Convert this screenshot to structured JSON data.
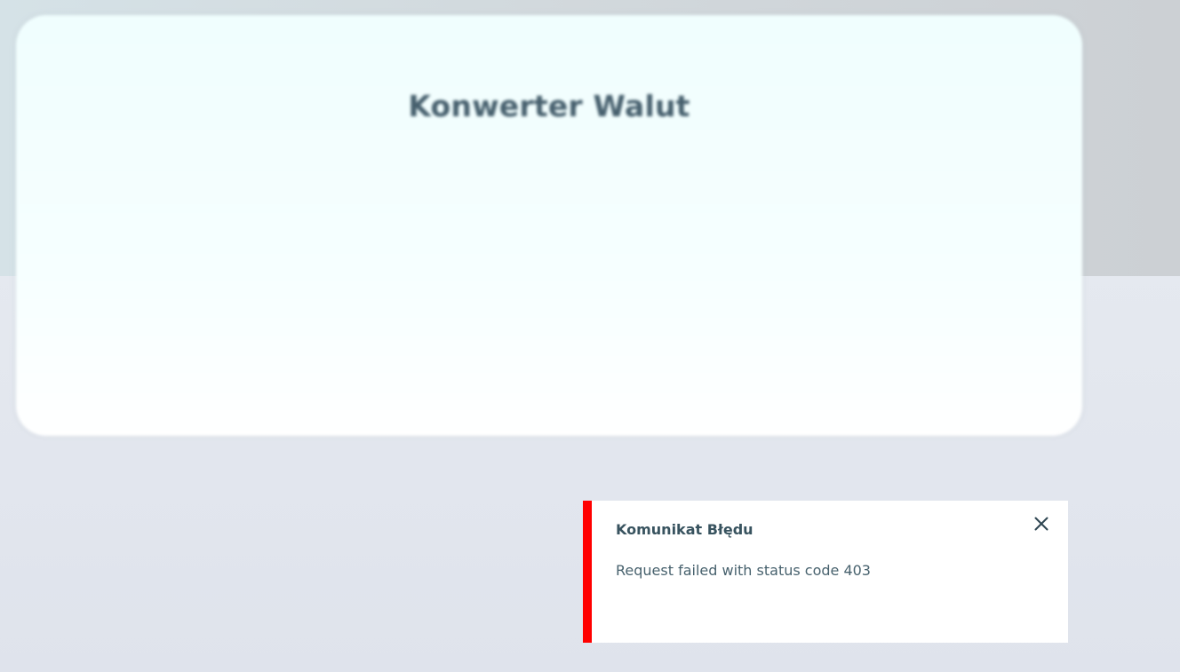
{
  "app": {
    "title": "Konwerter Walut"
  },
  "toast": {
    "type": "error",
    "title": "Komunikat Błędu",
    "message": "Request failed with status code 403",
    "close_icon": "close-icon",
    "accent_color": "#ff0000"
  }
}
